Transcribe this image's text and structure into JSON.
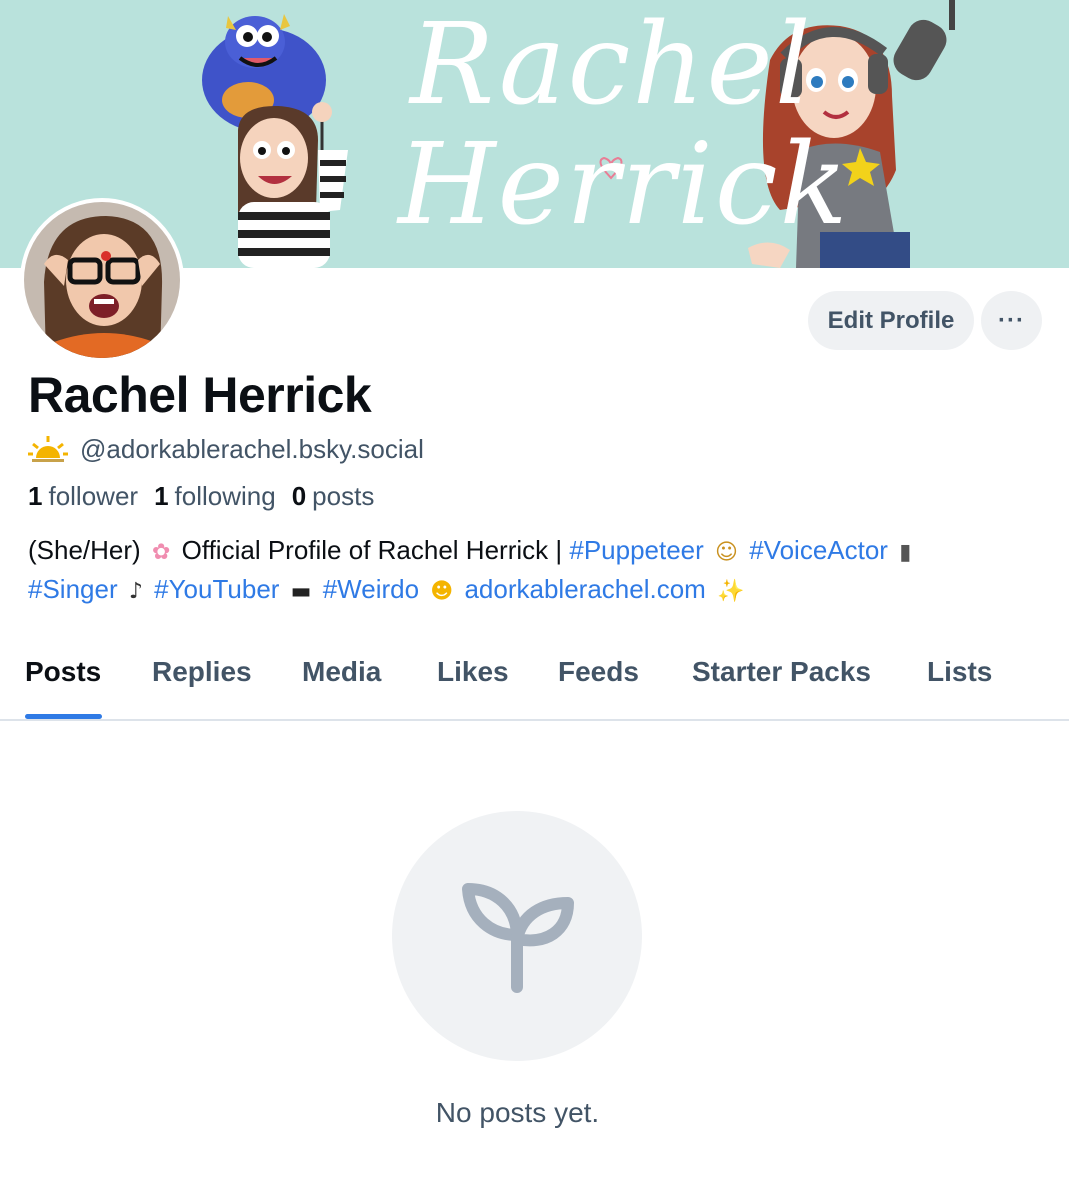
{
  "banner": {
    "first_word": "Rachel",
    "last_word": "Herrick"
  },
  "profile": {
    "name": "Rachel Herrick",
    "handle": "@adorkablerachel.bsky.social",
    "edit_button": "Edit Profile",
    "more_button": "···"
  },
  "stats": {
    "followers_count": "1",
    "followers_label": "follower",
    "following_count": "1",
    "following_label": "following",
    "posts_count": "0",
    "posts_label": "posts"
  },
  "bio": {
    "line1_text": "(She/Her)",
    "line1_text2": "Official Profile of Rachel Herrick |",
    "tag_puppeteer": "#Puppeteer",
    "tag_voiceactor": "#VoiceActor",
    "tag_singer": "#Singer",
    "tag_youtuber": "#YouTuber",
    "tag_weirdo": "#Weirdo",
    "link": "adorkablerachel.com"
  },
  "tabs": [
    {
      "label": "Posts",
      "active": true
    },
    {
      "label": "Replies"
    },
    {
      "label": "Media"
    },
    {
      "label": "Likes"
    },
    {
      "label": "Feeds"
    },
    {
      "label": "Starter Packs"
    },
    {
      "label": "Lists"
    }
  ],
  "empty_state": {
    "icon": "sprout-icon",
    "message": "No posts yet."
  },
  "colors": {
    "accent": "#2f7ae5",
    "banner_bg": "#b9e2dc",
    "muted_text": "#425466",
    "button_bg": "#eff1f3"
  }
}
